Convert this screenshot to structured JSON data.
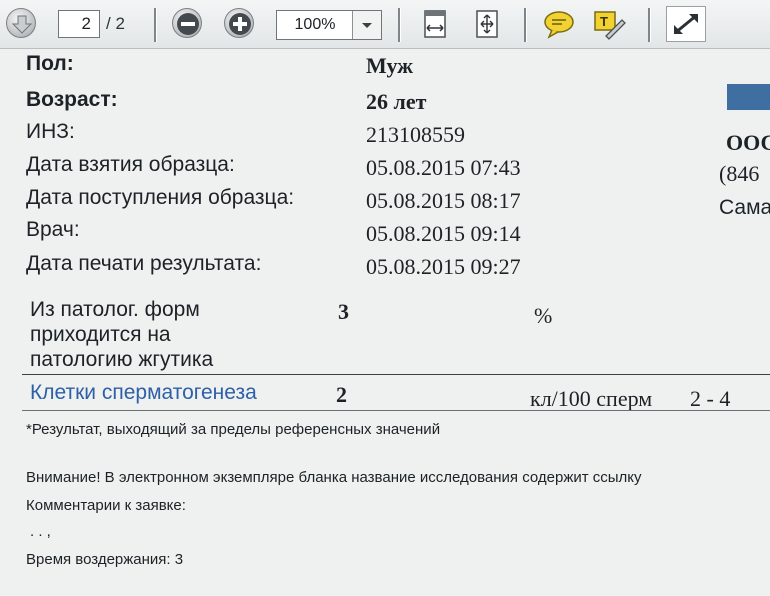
{
  "toolbar": {
    "page_current": "2",
    "page_total": "/ 2",
    "zoom_value": "100%",
    "icons": [
      "page-down-icon",
      "zoom-out-icon",
      "zoom-in-icon",
      "fit-width-icon",
      "fit-page-icon",
      "comment-icon",
      "typewriter-icon",
      "fullscreen-icon"
    ]
  },
  "patient": {
    "sex_label": "Пол:",
    "sex_value": "Муж",
    "age_label": "Возраст:",
    "age_value": "26 лет",
    "inz_label": "ИНЗ:",
    "inz_value": "213108559",
    "sample_taken_label": "Дата взятия образца:",
    "sample_taken_value": "05.08.2015 07:43",
    "sample_received_label": "Дата поступления образца:",
    "sample_received_value": "05.08.2015 08:17",
    "doctor_label": "Врач:",
    "doctor_value": "05.08.2015 09:14",
    "print_date_label": "Дата печати результата:",
    "print_date_value": "05.08.2015 09:27"
  },
  "org": {
    "name_partial": "ООС",
    "phone_partial": "(846",
    "city_partial": "Сама"
  },
  "results": {
    "pathology": {
      "label_lines": [
        "Из патолог. форм",
        "приходится на",
        "патологию жгутика"
      ],
      "value": "3",
      "unit": "%"
    },
    "spermatogenesis": {
      "label": "Клетки сперматогенеза",
      "value": "2",
      "unit": "кл/100 сперм",
      "reference": "2 - 4"
    }
  },
  "notes": {
    "footnote": "*Результат, выходящий за пределы референсных значений",
    "attention": "Внимание! В электронном экземпляре бланка название исследования содержит ссылку",
    "comments_label": "Комментарии к заявке:",
    "comments_value": ". . ,",
    "abstinence": "Время воздержания: 3"
  },
  "colors": {
    "accent_blue": "#3f6fa0",
    "link_blue": "#2f5fa6"
  }
}
